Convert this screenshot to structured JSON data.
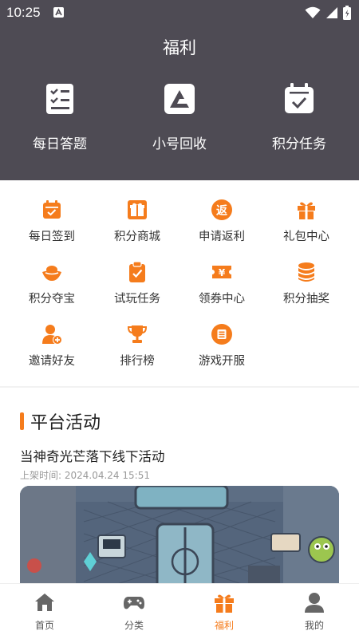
{
  "status_bar": {
    "time": "10:25"
  },
  "header": {
    "title": "福利"
  },
  "top_items": [
    {
      "label": "每日答题",
      "icon": "quiz-list-icon"
    },
    {
      "label": "小号回收",
      "icon": "recycle-triangle-icon"
    },
    {
      "label": "积分任务",
      "icon": "calendar-check-icon"
    }
  ],
  "welfare_items": [
    {
      "label": "每日签到",
      "icon": "checkin-calendar-icon"
    },
    {
      "label": "积分商城",
      "icon": "gift-box-icon"
    },
    {
      "label": "申请返利",
      "icon": "rebate-icon",
      "icon_text": "返"
    },
    {
      "label": "礼包中心",
      "icon": "gift-icon"
    },
    {
      "label": "积分夺宝",
      "icon": "treasure-ingot-icon"
    },
    {
      "label": "试玩任务",
      "icon": "clipboard-check-icon"
    },
    {
      "label": "领券中心",
      "icon": "coupon-icon",
      "icon_text": "¥"
    },
    {
      "label": "积分抽奖",
      "icon": "coin-stack-icon"
    },
    {
      "label": "邀请好友",
      "icon": "invite-user-icon"
    },
    {
      "label": "排行榜",
      "icon": "trophy-icon"
    },
    {
      "label": "游戏开服",
      "icon": "server-icon"
    }
  ],
  "platform": {
    "section_title": "平台活动",
    "activity_title": "当神奇光芒落下线下活动",
    "activity_time_label": "上架时间: 2024.04.24 15:51"
  },
  "tabs": [
    {
      "label": "首页",
      "icon": "home-icon"
    },
    {
      "label": "分类",
      "icon": "gamepad-icon"
    },
    {
      "label": "福利",
      "icon": "gift-icon"
    },
    {
      "label": "我的",
      "icon": "user-icon"
    }
  ],
  "colors": {
    "accent": "#f57c1c",
    "header_bg": "#4e4b54"
  }
}
